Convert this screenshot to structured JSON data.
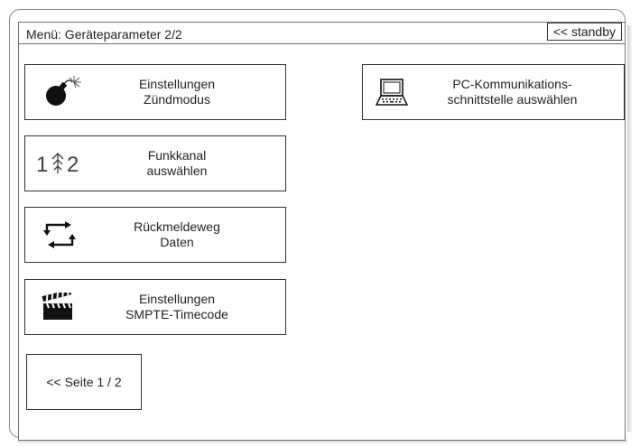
{
  "header": {
    "title": "Menü: Geräteparameter 2/2",
    "standby_label": "<< standby"
  },
  "menu": {
    "firing_mode": {
      "line1": "Einstellungen",
      "line2": "Zündmodus",
      "icon": "bomb-icon"
    },
    "radio_channel": {
      "line1": "Funkkanal",
      "line2": "auswählen",
      "icon": "radio-channel-icon"
    },
    "feedback_path": {
      "line1": "Rückmeldeweg",
      "line2": "Daten",
      "icon": "feedback-loop-icon"
    },
    "smpte": {
      "line1": "Einstellungen",
      "line2": "SMPTE-Timecode",
      "icon": "clapperboard-icon"
    },
    "pc_interface": {
      "line1": "PC-Kommunikations-",
      "line2": "schnittstelle auswählen",
      "icon": "laptop-icon"
    }
  },
  "footer": {
    "back_label": "<< Seite 1 / 2"
  },
  "colors": {
    "border": "#333333",
    "frame": "#8a8a8a",
    "text": "#222222"
  }
}
